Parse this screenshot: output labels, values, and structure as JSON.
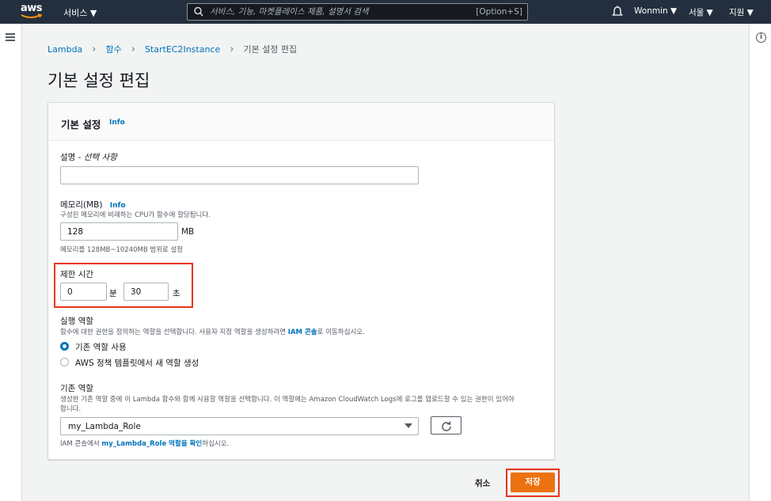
{
  "topnav": {
    "logo_text": "aws",
    "services_label": "서비스 ▼",
    "search_placeholder": "서비스, 기능, 마켓플레이스 제품, 설명서 검색",
    "search_shortcut": "[Option+S]",
    "user_label": "Wonmin ▼",
    "region_label": "서울 ▼",
    "support_label": "지원 ▼"
  },
  "breadcrumb": {
    "items": [
      "Lambda",
      "함수",
      "StartEC2Instance"
    ],
    "current": "기본 설정 편집"
  },
  "page_title": "기본 설정 편집",
  "panel": {
    "title": "기본 설정",
    "info": "Info",
    "description": {
      "label": "설명 - ",
      "label_optional": "선택 사항",
      "value": ""
    },
    "memory": {
      "label": "메모리(MB)",
      "info": "Info",
      "hint": "구성된 메모리에 비례하는 CPU가 함수에 할당됩니다.",
      "value": "128",
      "unit": "MB",
      "range_hint": "메모리를 128MB~10240MB 범위로 설정"
    },
    "timeout": {
      "label": "제한 시간",
      "minutes_value": "0",
      "minutes_unit": "분",
      "seconds_value": "30",
      "seconds_unit": "초"
    },
    "execution_role": {
      "label": "실행 역할",
      "hint_prefix": "함수에 대한 권한을 정의하는 역할을 선택합니다. 사용자 지정 역할을 생성하려면 ",
      "hint_link": "IAM 콘솔",
      "hint_suffix": "로 이동하십시오.",
      "options": [
        "기존 역할 사용",
        "AWS 정책 템플릿에서 새 역할 생성"
      ],
      "selected_index": 0
    },
    "existing_role": {
      "label": "기존 역할",
      "hint_line1": "생성한 기존 역할 중에 이 Lambda 함수와 함께 사용할 역할을 선택합니다. 이 역할에는 Amazon CloudWatch Logs에 로그를 업로드할 수 있는 권한이 있어야",
      "hint_line2": "합니다.",
      "selected": "my_Lambda_Role",
      "footer_prefix": "IAM 콘솔에서 ",
      "footer_link": "my_Lambda_Role 역할을 확인",
      "footer_suffix": "하십시오."
    }
  },
  "actions": {
    "cancel": "취소",
    "save": "저장"
  },
  "colors": {
    "nav_bg": "#232f3e",
    "link": "#0073bb",
    "primary_button": "#ec7211",
    "highlight_box": "#e8341c"
  },
  "icons": [
    "aws-logo",
    "search-icon",
    "bell-icon",
    "hamburger-icon",
    "info-icon",
    "refresh-icon",
    "chevron-down-icon"
  ]
}
